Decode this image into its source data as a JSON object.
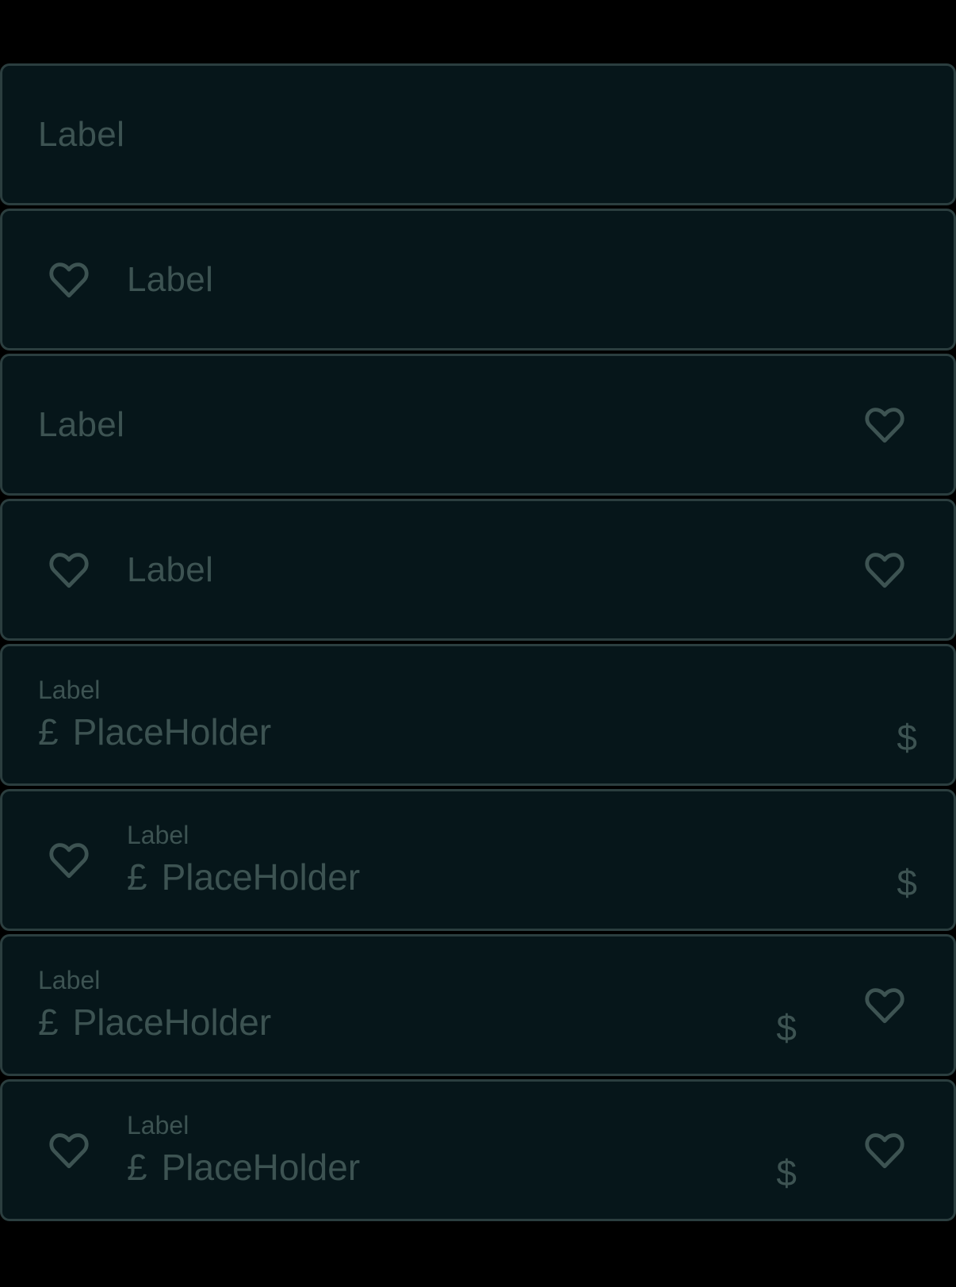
{
  "colors": {
    "background": "#000000",
    "field_background": "#06161a",
    "field_border": "#2b3e3f",
    "text": "#3d5352"
  },
  "icons": {
    "leading": "heart-icon",
    "trailing": "heart-icon"
  },
  "fields": [
    {
      "label": "Label"
    },
    {
      "label": "Label"
    },
    {
      "label": "Label"
    },
    {
      "label": "Label"
    },
    {
      "label": "Label",
      "prefix": "£",
      "placeholder": "PlaceHolder",
      "suffix": "$"
    },
    {
      "label": "Label",
      "prefix": "£",
      "placeholder": "PlaceHolder",
      "suffix": "$"
    },
    {
      "label": "Label",
      "prefix": "£",
      "placeholder": "PlaceHolder",
      "suffix": "$"
    },
    {
      "label": "Label",
      "prefix": "£",
      "placeholder": "PlaceHolder",
      "suffix": "$"
    }
  ]
}
